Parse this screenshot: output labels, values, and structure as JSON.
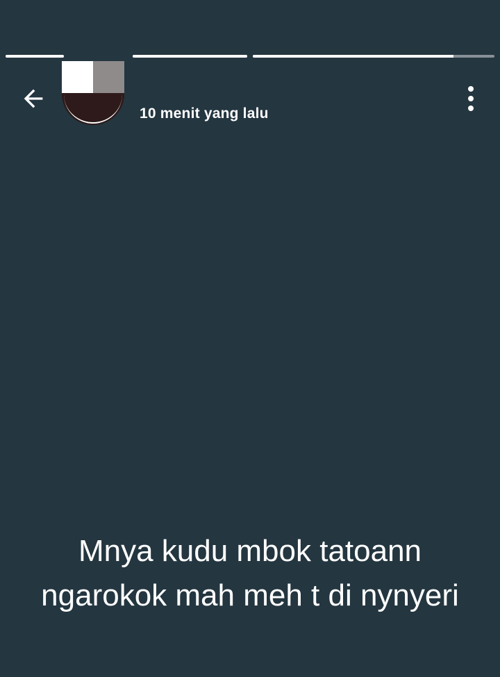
{
  "status": {
    "timestamp": "10 menit yang lalu"
  },
  "progress": {
    "segments": [
      {
        "fill_fraction": 1.0
      },
      {
        "fill_fraction": 1.0
      },
      {
        "fill_fraction": 0.83
      }
    ]
  },
  "icons": {
    "back": "arrow-left-icon",
    "menu": "more-vertical-icon"
  },
  "colors": {
    "background": "#243640",
    "text": "#ffffff",
    "progress_track": "rgba(255,255,255,0.45)",
    "progress_fill": "#ffffff"
  },
  "story": {
    "caption_line1": "Mnya kudu mbok tatoann",
    "caption_line2": "ngarokok mah meh t di nynyeri"
  }
}
